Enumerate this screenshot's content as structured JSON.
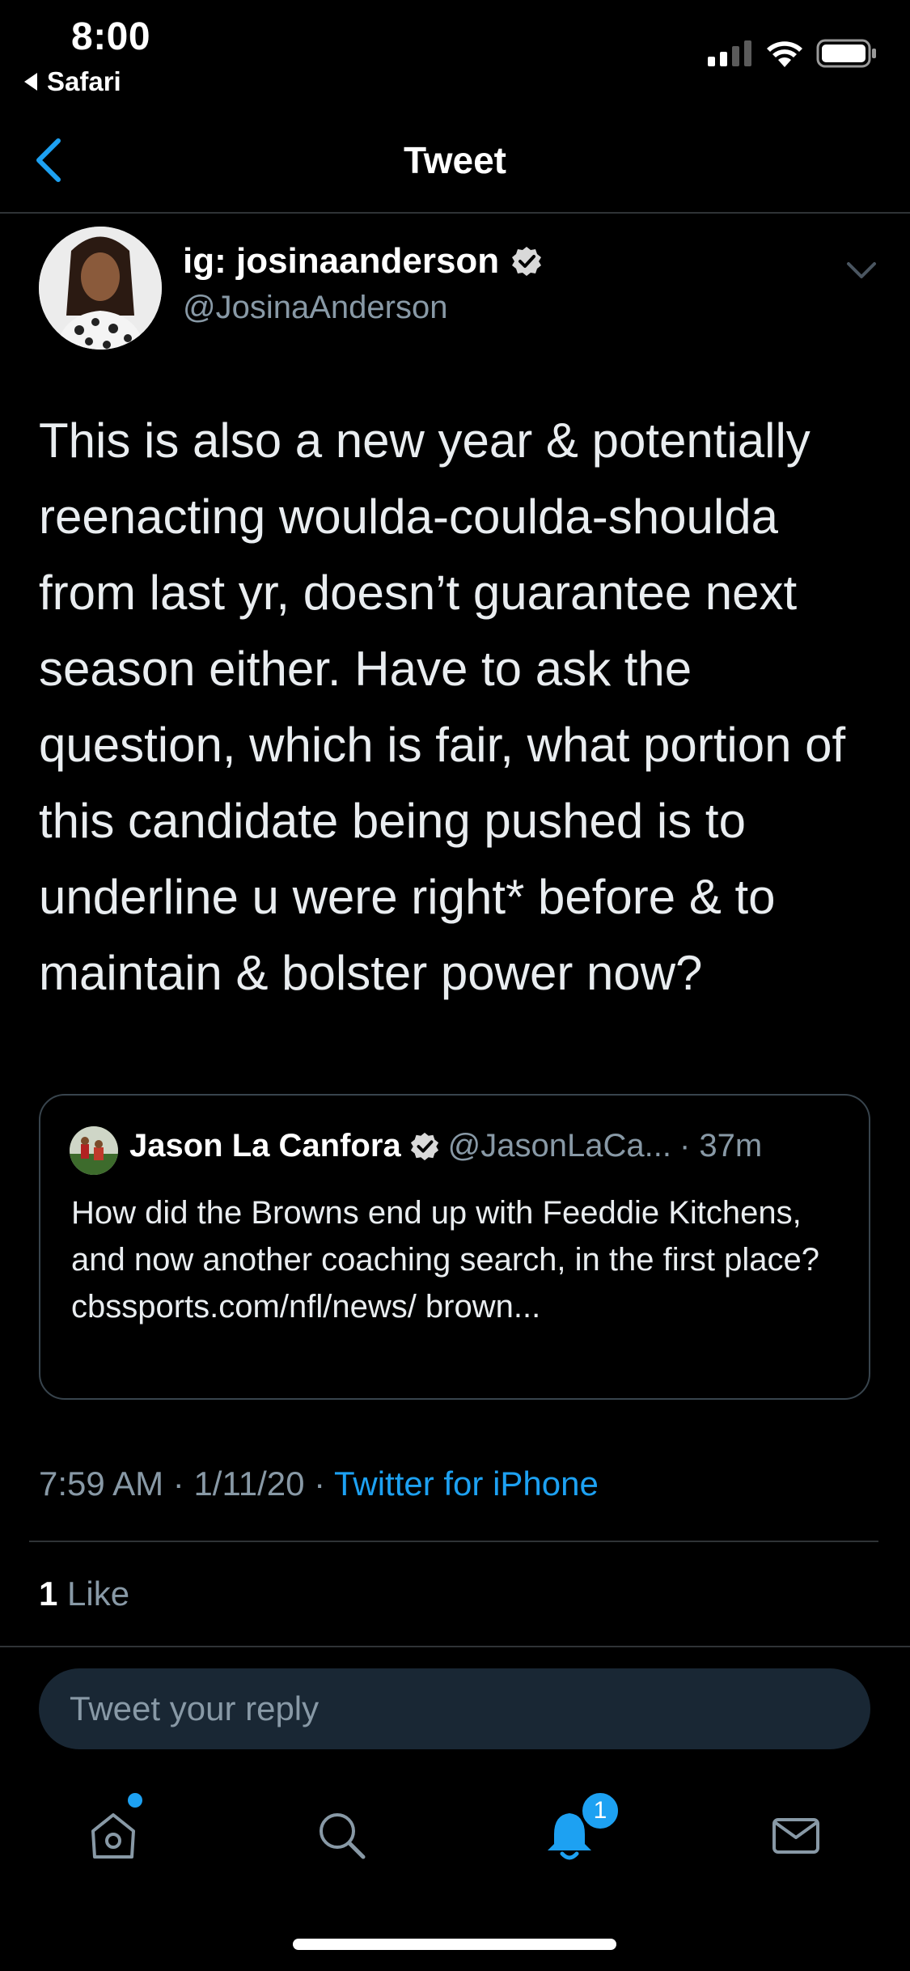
{
  "status_bar": {
    "time": "8:00",
    "back_app": "Safari"
  },
  "nav": {
    "title": "Tweet"
  },
  "tweet": {
    "author_name": "ig: josinaanderson",
    "author_handle": "@JosinaAnderson",
    "text": "This is also a new year & potentially reenacting woulda-coulda-shoulda from last yr, doesn’t guarantee next season either. Have to ask the question, which is fair, what portion of this candidate being pushed is to underline u were right* before & to maintain & bolster power now?",
    "time": "7:59 AM",
    "date": "1/11/20",
    "source": "Twitter for iPhone",
    "separator": " · ",
    "like_count": "1",
    "like_label": "Like"
  },
  "quoted_tweet": {
    "name": "Jason La Canfora",
    "handle": "@JasonLaCa...",
    "age": "· 37m",
    "text": "How did the Browns end up with Feeddie Kitchens, and now another coaching search, in the first place? cbssports.com/nfl/news/ brown..."
  },
  "reply": {
    "placeholder": "Tweet your reply"
  },
  "tab_bar": {
    "notification_badge": "1"
  },
  "colors": {
    "accent": "#1da1f2",
    "muted": "#8899a6",
    "background": "#000000"
  },
  "icons": [
    "wifi-icon",
    "signal-icon",
    "battery-icon",
    "back-chevron-icon",
    "verified-badge-icon",
    "more-chevron-icon",
    "home-icon",
    "search-icon",
    "bell-icon",
    "mail-icon"
  ]
}
